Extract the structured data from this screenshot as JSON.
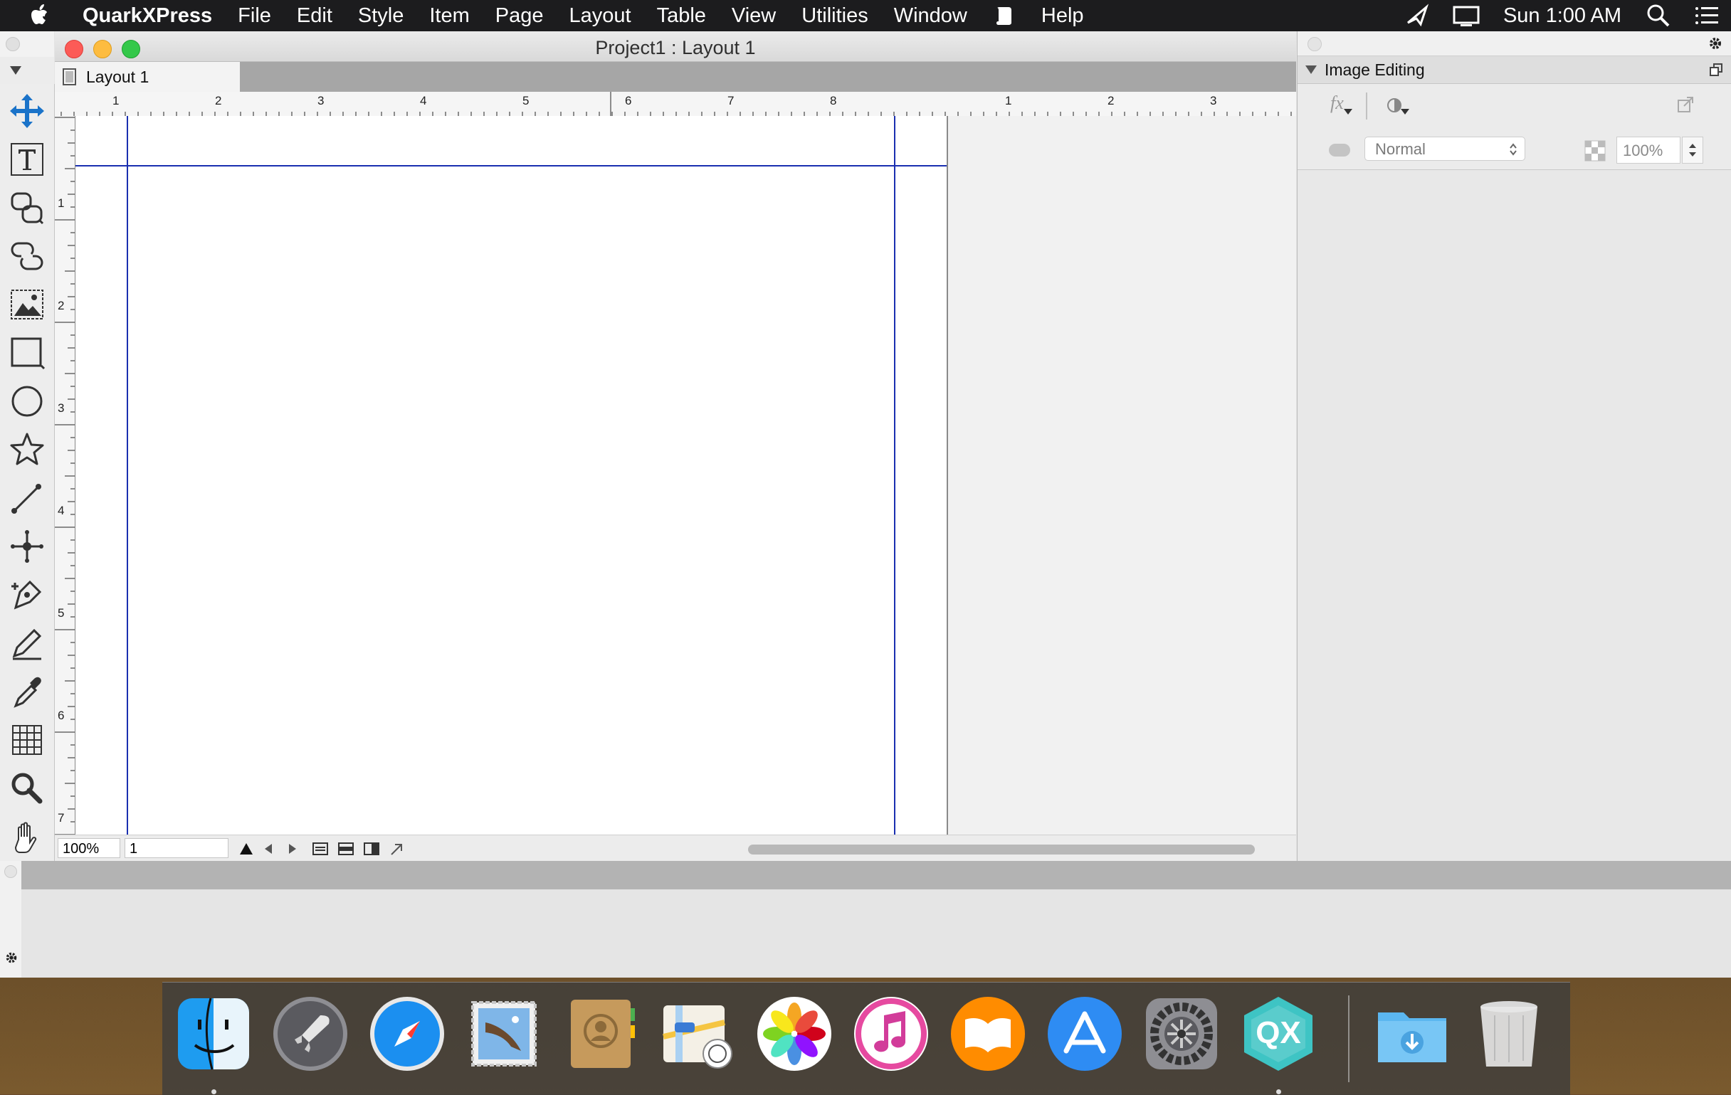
{
  "menubar": {
    "app_name": "QuarkXPress",
    "items": [
      "File",
      "Edit",
      "Style",
      "Item",
      "Page",
      "Layout",
      "Table",
      "View",
      "Utilities",
      "Window",
      "Help"
    ],
    "clock": "Sun 1:00 AM"
  },
  "document": {
    "title": "Project1 : Layout 1",
    "tab_label": "Layout 1"
  },
  "ruler": {
    "top_labels": [
      "1",
      "2",
      "3",
      "4",
      "5",
      "6",
      "7",
      "8",
      "1",
      "2",
      "3"
    ],
    "left_labels": [
      "1",
      "2",
      "3",
      "4",
      "5",
      "6",
      "7"
    ]
  },
  "tools": [
    "item-tool",
    "text-content-tool",
    "text-linking-tool",
    "text-unlinking-tool",
    "picture-content-tool",
    "rectangle-box-tool",
    "oval-box-tool",
    "starburst-tool",
    "line-tool",
    "bezier-point-tool",
    "bezier-pen-tool",
    "freehand-tool",
    "eyedropper-tool",
    "table-tool",
    "zoom-tool",
    "pan-tool"
  ],
  "status": {
    "zoom": "100%",
    "page": "1"
  },
  "palette": {
    "title": "Image Editing",
    "fx_label": "fx",
    "blend_mode": "Normal",
    "opacity": "100%"
  },
  "dock": {
    "apps": [
      "Finder",
      "Launchpad",
      "Safari",
      "Mail",
      "Contacts",
      "Maps",
      "Photos",
      "iTunes",
      "iBooks",
      "App Store",
      "System Preferences",
      "QuarkXPress",
      "Downloads",
      "Trash"
    ],
    "qx_label": "QX"
  },
  "colors": {
    "accent": "#1a73c9",
    "guide": "#1a2fb0",
    "close": "#fc5b57",
    "minimize": "#fdbc40",
    "zoom": "#34c84a"
  }
}
